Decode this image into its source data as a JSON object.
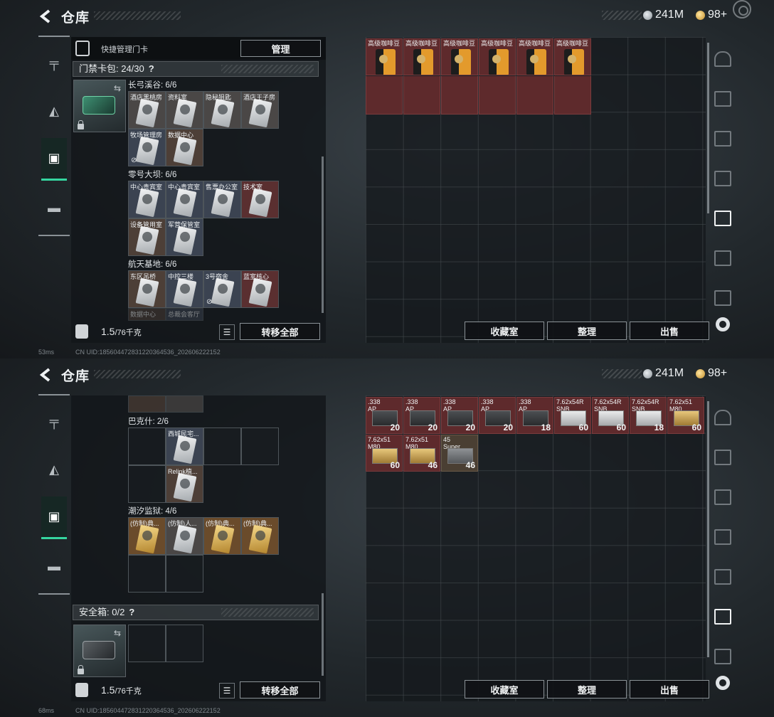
{
  "app": {
    "title": "仓库",
    "currency": {
      "silver": "241M",
      "gold": "98+"
    }
  },
  "left_nav": [
    "gun-icon",
    "helmet-icon",
    "keycard-icon",
    "toolbox-icon"
  ],
  "right_bar": [
    "home-icon",
    "tier3-stash-icon",
    "tier3-stash-icon",
    "tier3-map-icon",
    "tier5-stash-icon",
    "tier4-stash-icon",
    "tier4-stash-icon"
  ],
  "screens": [
    {
      "quick_label": "快捷管理门卡",
      "manage_btn": "管理",
      "keycard_bag": "门禁卡包: 24/30",
      "groups": [
        {
          "name": "长弓溪谷: 6/6",
          "cards": [
            "酒店黑桃房",
            "资料室",
            "隐秘狙匙",
            "酒店王子房",
            "牧场管理房",
            "数据中心"
          ]
        },
        {
          "name": "零号大坝: 6/6",
          "cards": [
            "中心贵宾室",
            "中心贵宾室",
            "售票办公室",
            "技术室",
            "设备管用室",
            "军营保管室"
          ]
        },
        {
          "name": "航天基地: 6/6",
          "cards": [
            "东区吊桥",
            "中控三楼",
            "3号宿舍",
            "蓝室核心",
            "数据中心",
            "总裁会客厅"
          ]
        }
      ],
      "weight": "1.5",
      "weight_unit": "/76千克",
      "transfer_all": "转移全部",
      "stash_items": [
        {
          "label": "高级咖啡豆"
        },
        {
          "label": "高级咖啡豆"
        },
        {
          "label": "高级咖啡豆"
        },
        {
          "label": "高级咖啡豆"
        },
        {
          "label": "高级咖啡豆"
        },
        {
          "label": "高级咖啡豆"
        }
      ],
      "btn_collection": "收藏室",
      "btn_sort": "整理",
      "btn_sell": "出售",
      "status": {
        "ping": "53ms",
        "uid": "CN UID:18560447283122036453­6_202606222152"
      }
    },
    {
      "groups": [
        {
          "name": "巴克什: 2/6",
          "cards": [
            "西城民宅...",
            "Relink植..."
          ]
        },
        {
          "name": "潮汐监狱: 4/6",
          "cards": [
            "(仿制)典...",
            "(仿制)人...",
            "(仿制)典...",
            "(仿制)典..."
          ]
        }
      ],
      "safe_box": "安全箱: 0/2",
      "weight": "1.5",
      "weight_unit": "/76千克",
      "transfer_all": "转移全部",
      "stash_items": [
        {
          "label": ".338\nAP",
          "count": "20"
        },
        {
          "label": ".338\nAP",
          "count": "20"
        },
        {
          "label": ".338\nAP",
          "count": "20"
        },
        {
          "label": ".338\nAP",
          "count": "20"
        },
        {
          "label": ".338\nAP",
          "count": "18"
        },
        {
          "label": "7.62x54R\nSNB",
          "count": "60"
        },
        {
          "label": "7.62x54R\nSNB",
          "count": "60"
        },
        {
          "label": "7.62x54R\nSNB",
          "count": "18"
        },
        {
          "label": "7.62x51\nM80",
          "count": "60"
        },
        {
          "label": "7.62x51\nM80",
          "count": "60"
        },
        {
          "label": "7.62x51\nM80",
          "count": "46"
        },
        {
          "label": "45\nSuper",
          "count": "46"
        }
      ],
      "btn_collection": "收藏室",
      "btn_sort": "整理",
      "btn_sell": "出售",
      "status": {
        "ping": "68ms",
        "uid": "CN UID:18560447283122036453­6_202606222152"
      }
    }
  ]
}
